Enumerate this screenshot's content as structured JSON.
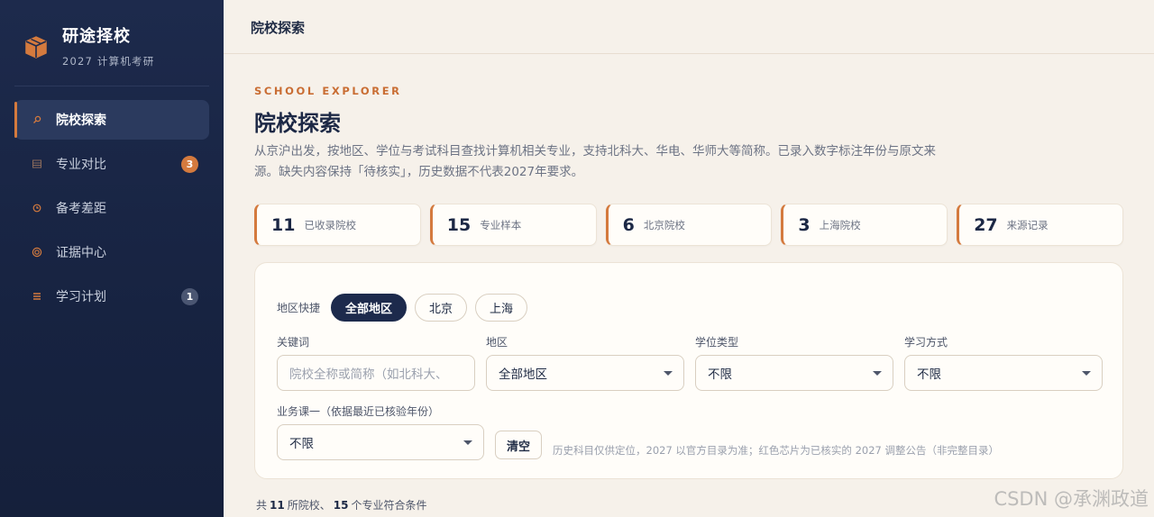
{
  "sidebar": {
    "brand_title": "研途择校",
    "brand_subtitle": "2027 计算机考研",
    "items": [
      {
        "label": "院校探索",
        "icon": "search-icon",
        "active": true
      },
      {
        "label": "专业对比",
        "icon": "compare-icon",
        "badge": "3"
      },
      {
        "label": "备考差距",
        "icon": "clock-icon"
      },
      {
        "label": "证据中心",
        "icon": "target-icon"
      },
      {
        "label": "学习计划",
        "icon": "list-icon",
        "badge": "1"
      }
    ]
  },
  "header": {
    "title": "院校探索"
  },
  "main": {
    "eyebrow": "SCHOOL EXPLORER",
    "title": "院校探索",
    "intro": "从京沪出发，按地区、学位与考试科目查找计算机相关专业，支持北科大、华电、华师大等简称。已录入数字标注年份与原文来源。缺失内容保持「待核实」，历史数据不代表2027年要求。"
  },
  "stats": [
    {
      "value": "11",
      "label": "已收录院校"
    },
    {
      "value": "15",
      "label": "专业样本"
    },
    {
      "value": "6",
      "label": "北京院校"
    },
    {
      "value": "3",
      "label": "上海院校"
    },
    {
      "value": "27",
      "label": "来源记录"
    }
  ],
  "filters": {
    "quick_label": "地区快捷",
    "quick_chips": [
      "全部地区",
      "北京",
      "上海"
    ],
    "keyword_label": "关键词",
    "keyword_placeholder": "院校全称或简称（如北科大、",
    "region_label": "地区",
    "region_value": "全部地区",
    "degree_label": "学位类型",
    "degree_value": "不限",
    "study_label": "学习方式",
    "study_value": "不限",
    "course_label": "业务课一（依据最近已核验年份）",
    "course_value": "不限",
    "clear_label": "清空",
    "hint": "历史科目仅供定位，2027 以官方目录为准；红色芯片为已核实的 2027 调整公告（非完整目录）"
  },
  "summary": {
    "prefix": "共",
    "school_count": "11",
    "middle": "所院校、",
    "major_count": "15",
    "suffix": "个专业符合条件"
  },
  "watermark": "CSDN @承渊政道",
  "colors": {
    "accent": "#d47a3e",
    "sidebar": "#1d2a4c",
    "background": "#f6f1ea"
  }
}
